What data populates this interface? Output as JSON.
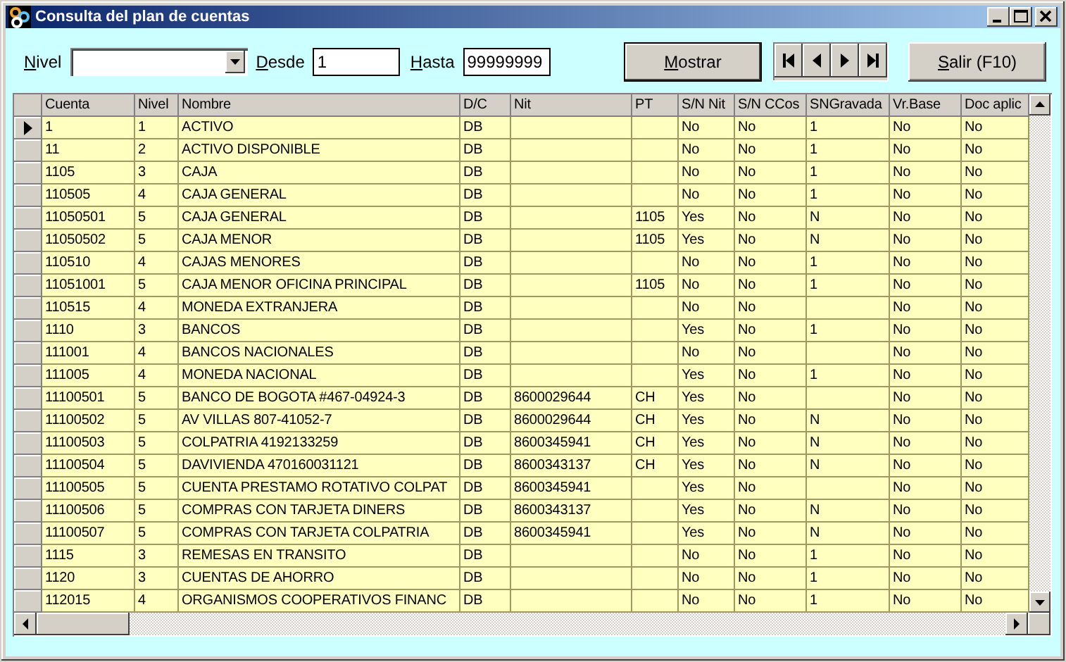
{
  "window": {
    "title": "Consulta del plan de cuentas"
  },
  "filters": {
    "nivel_label": "Nivel",
    "desde_label": "Desde",
    "desde_value": "1",
    "hasta_label": "Hasta",
    "hasta_value": "99999999"
  },
  "buttons": {
    "show": "Mostrar",
    "exit": "Salir (F10)"
  },
  "table": {
    "columns": [
      "Cuenta",
      "Nivel",
      "Nombre",
      "D/C",
      "Nit",
      "PT",
      "S/N Nit",
      "S/N CCos",
      "SNGravada",
      "Vr.Base",
      "Doc aplic"
    ],
    "rows": [
      {
        "selected": true,
        "cells": [
          "1",
          "1",
          "ACTIVO",
          "DB",
          "",
          "",
          "No",
          "No",
          "1",
          "No",
          "No"
        ]
      },
      {
        "selected": false,
        "cells": [
          "11",
          "2",
          "ACTIVO DISPONIBLE",
          "DB",
          "",
          "",
          "No",
          "No",
          "1",
          "No",
          "No"
        ]
      },
      {
        "selected": false,
        "cells": [
          "1105",
          "3",
          "CAJA",
          "DB",
          "",
          "",
          "No",
          "No",
          "1",
          "No",
          "No"
        ]
      },
      {
        "selected": false,
        "cells": [
          "110505",
          "4",
          "CAJA GENERAL",
          "DB",
          "",
          "",
          "No",
          "No",
          "1",
          "No",
          "No"
        ]
      },
      {
        "selected": false,
        "cells": [
          "11050501",
          "5",
          "CAJA GENERAL",
          "DB",
          "",
          "1105",
          "Yes",
          "No",
          "N",
          "No",
          "No"
        ]
      },
      {
        "selected": false,
        "cells": [
          "11050502",
          "5",
          "CAJA MENOR",
          "DB",
          "",
          "1105",
          "Yes",
          "No",
          "N",
          "No",
          "No"
        ]
      },
      {
        "selected": false,
        "cells": [
          "110510",
          "4",
          "CAJAS MENORES",
          "DB",
          "",
          "",
          "No",
          "No",
          "1",
          "No",
          "No"
        ]
      },
      {
        "selected": false,
        "cells": [
          "11051001",
          "5",
          "CAJA MENOR OFICINA PRINCIPAL",
          "DB",
          "",
          "1105",
          "No",
          "No",
          "1",
          "No",
          "No"
        ]
      },
      {
        "selected": false,
        "cells": [
          "110515",
          "4",
          "MONEDA EXTRANJERA",
          "DB",
          "",
          "",
          "No",
          "No",
          "",
          "No",
          "No"
        ]
      },
      {
        "selected": false,
        "cells": [
          "1110",
          "3",
          "BANCOS",
          "DB",
          "",
          "",
          "Yes",
          "No",
          "1",
          "No",
          "No"
        ]
      },
      {
        "selected": false,
        "cells": [
          "111001",
          "4",
          "BANCOS NACIONALES",
          "DB",
          "",
          "",
          "No",
          "No",
          "",
          "No",
          "No"
        ]
      },
      {
        "selected": false,
        "cells": [
          "111005",
          "4",
          "MONEDA NACIONAL",
          "DB",
          "",
          "",
          "Yes",
          "No",
          "1",
          "No",
          "No"
        ]
      },
      {
        "selected": false,
        "cells": [
          "11100501",
          "5",
          "BANCO DE BOGOTA #467-04924-3",
          "DB",
          "8600029644",
          "CH",
          "Yes",
          "No",
          "",
          "No",
          "No"
        ]
      },
      {
        "selected": false,
        "cells": [
          "11100502",
          "5",
          "AV VILLAS 807-41052-7",
          "DB",
          "8600029644",
          "CH",
          "Yes",
          "No",
          "N",
          "No",
          "No"
        ]
      },
      {
        "selected": false,
        "cells": [
          "11100503",
          "5",
          "COLPATRIA 4192133259",
          "DB",
          "8600345941",
          "CH",
          "Yes",
          "No",
          "N",
          "No",
          "No"
        ]
      },
      {
        "selected": false,
        "cells": [
          "11100504",
          "5",
          "DAVIVIENDA 470160031121",
          "DB",
          "8600343137",
          "CH",
          "Yes",
          "No",
          "N",
          "No",
          "No"
        ]
      },
      {
        "selected": false,
        "cells": [
          "11100505",
          "5",
          "CUENTA PRESTAMO ROTATIVO COLPAT",
          "DB",
          "8600345941",
          "",
          "Yes",
          "No",
          "",
          "No",
          "No"
        ]
      },
      {
        "selected": false,
        "cells": [
          "11100506",
          "5",
          "COMPRAS CON TARJETA DINERS",
          "DB",
          "8600343137",
          "",
          "Yes",
          "No",
          "N",
          "No",
          "No"
        ]
      },
      {
        "selected": false,
        "cells": [
          "11100507",
          "5",
          "COMPRAS CON TARJETA COLPATRIA",
          "DB",
          "8600345941",
          "",
          "Yes",
          "No",
          "N",
          "No",
          "No"
        ]
      },
      {
        "selected": false,
        "cells": [
          "1115",
          "3",
          "REMESAS EN TRANSITO",
          "DB",
          "",
          "",
          "No",
          "No",
          "1",
          "No",
          "No"
        ]
      },
      {
        "selected": false,
        "cells": [
          "1120",
          "3",
          "CUENTAS DE AHORRO",
          "DB",
          "",
          "",
          "No",
          "No",
          "1",
          "No",
          "No"
        ]
      },
      {
        "selected": false,
        "cells": [
          "112015",
          "4",
          "ORGANISMOS COOPERATIVOS FINANC",
          "DB",
          "",
          "",
          "No",
          "No",
          "1",
          "No",
          "No"
        ]
      }
    ]
  }
}
